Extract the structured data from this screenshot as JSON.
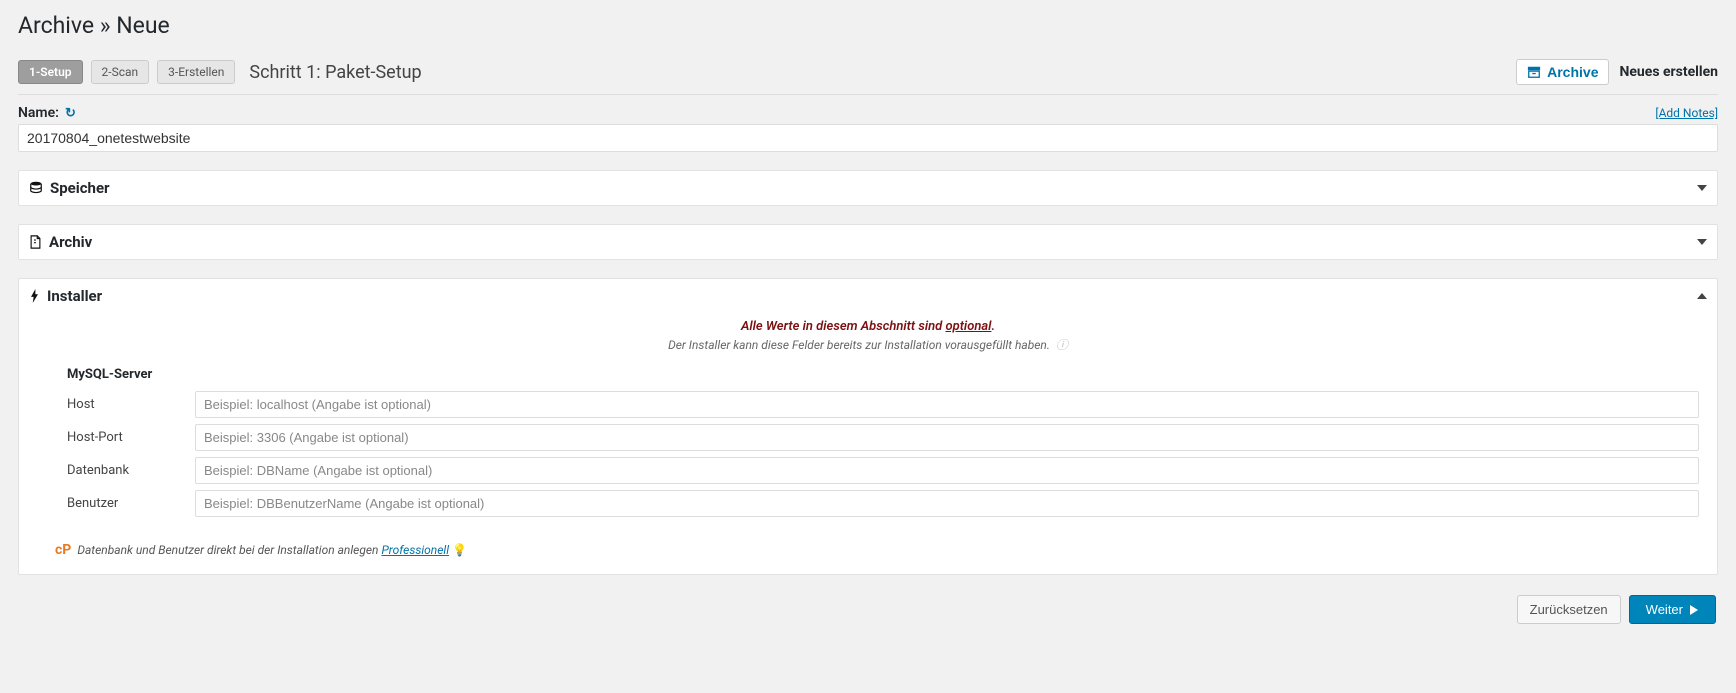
{
  "header": {
    "title": "Archive » Neue"
  },
  "wizard": {
    "steps": [
      "1-Setup",
      "2-Scan",
      "3-Erstellen"
    ],
    "active_index": 0,
    "step_title": "Schritt 1: Paket-Setup"
  },
  "topright": {
    "archive_btn": "Archive",
    "new_create": "Neues erstellen"
  },
  "name_section": {
    "label": "Name:",
    "add_notes": "[Add Notes]",
    "value": "20170804_onetestwebsite"
  },
  "panels": {
    "storage": {
      "title": "Speicher"
    },
    "archive": {
      "title": "Archiv"
    },
    "installer": {
      "title": "Installer",
      "notice_prefix": "Alle Werte in diesem Abschnitt sind ",
      "notice_underlined": "optional",
      "notice_suffix": ".",
      "subnotice": "Der Installer kann diese Felder bereits zur Installation vorausgefüllt haben.",
      "section_heading": "MySQL-Server",
      "fields": {
        "host": {
          "label": "Host",
          "placeholder": "Beispiel: localhost (Angabe ist optional)"
        },
        "host_port": {
          "label": "Host-Port",
          "placeholder": "Beispiel: 3306 (Angabe ist optional)"
        },
        "database": {
          "label": "Datenbank",
          "placeholder": "Beispiel: DBName (Angabe ist optional)"
        },
        "user": {
          "label": "Benutzer",
          "placeholder": "Beispiel: DBBenutzerName (Angabe ist optional)"
        }
      },
      "footer_note_text": "Datenbank und Benutzer direkt bei der Installation anlegen ",
      "footer_note_link": "Professionell"
    }
  },
  "actions": {
    "reset": "Zurücksetzen",
    "next": "Weiter"
  }
}
